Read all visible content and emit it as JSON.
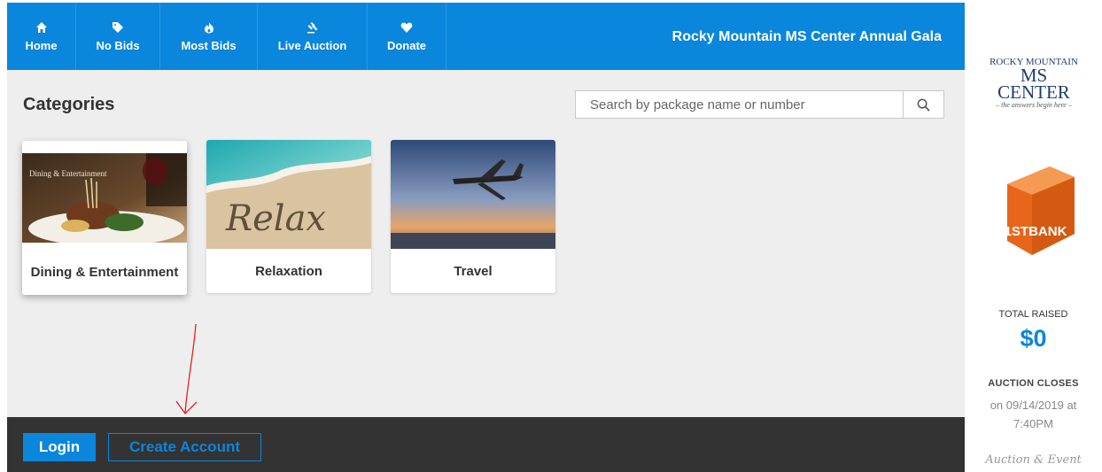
{
  "nav": {
    "items": [
      {
        "label": "Home",
        "icon": "home-icon"
      },
      {
        "label": "No Bids",
        "icon": "tag-icon"
      },
      {
        "label": "Most Bids",
        "icon": "flame-icon"
      },
      {
        "label": "Live Auction",
        "icon": "gavel-icon"
      },
      {
        "label": "Donate",
        "icon": "heart-icon"
      }
    ],
    "event_title": "Rocky Mountain MS Center Annual Gala"
  },
  "main": {
    "title": "Categories",
    "search": {
      "placeholder": "Search by package name or number",
      "value": ""
    },
    "categories": [
      {
        "label": "Dining & Entertainment",
        "image_caption": "Dining & Entertainment"
      },
      {
        "label": "Relaxation",
        "image_text": "Relax"
      },
      {
        "label": "Travel"
      }
    ]
  },
  "footer": {
    "login_label": "Login",
    "create_account_label": "Create Account"
  },
  "sidebar": {
    "sponsor": {
      "line1": "ROCKY MOUNTAIN",
      "line2": "MS CENTER",
      "line3": "– the answers begin here –"
    },
    "bank_logo_text": "1STBANK",
    "total_raised_label": "TOTAL RAISED",
    "total_raised_value": "$0",
    "auction_closes_label": "AUCTION CLOSES",
    "auction_closes_date": "on 09/14/2019 at 7:40PM",
    "footer_logo_text": "Auction & Event"
  },
  "colors": {
    "accent": "#0a86dc",
    "bottom_bar": "#333333",
    "background": "#eeeeee"
  }
}
